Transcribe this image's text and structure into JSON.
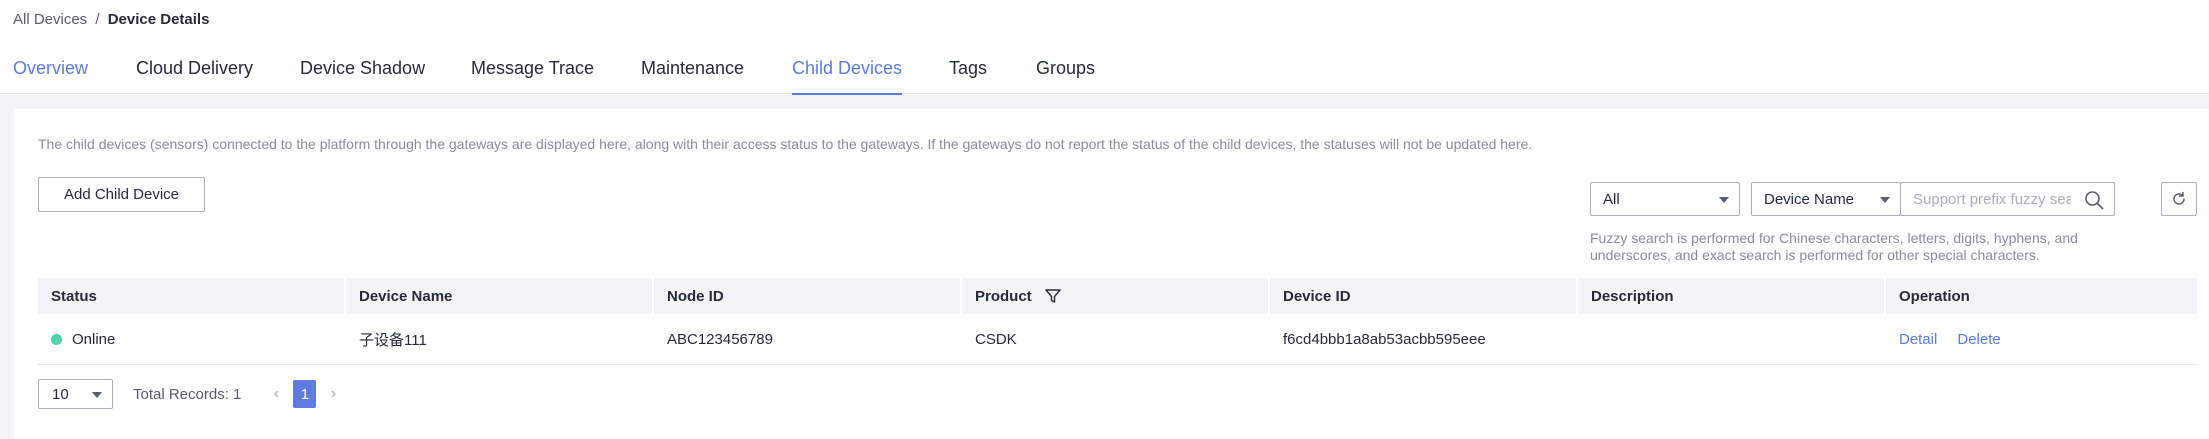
{
  "breadcrumb": {
    "parent": "All Devices",
    "separator": "/",
    "current": "Device Details"
  },
  "tabs": [
    {
      "label": "Overview"
    },
    {
      "label": "Cloud Delivery"
    },
    {
      "label": "Device Shadow"
    },
    {
      "label": "Message Trace"
    },
    {
      "label": "Maintenance"
    },
    {
      "label": "Child Devices"
    },
    {
      "label": "Tags"
    },
    {
      "label": "Groups"
    }
  ],
  "active_tab": "Child Devices",
  "hint": "The child devices (sensors) connected to the platform through the gateways are displayed here, along with their access status to the gateways. If the gateways do not report the status of the child devices, the statuses will not be updated here.",
  "toolbar": {
    "add_label": "Add Child Device",
    "status_filter": "All",
    "search_field": "Device Name",
    "search_placeholder": "Support prefix fuzzy search",
    "search_value": ""
  },
  "fuzzy_note": "Fuzzy search is performed for Chinese characters, letters, digits, hyphens, and underscores, and exact search is performed for other special characters.",
  "table": {
    "columns": [
      "Status",
      "Device Name",
      "Node ID",
      "Product",
      "Device ID",
      "Description",
      "Operation"
    ],
    "rows": [
      {
        "status": "Online",
        "status_color": "#50d4ab",
        "device_name": "子设备111",
        "node_id": "ABC123456789",
        "product": "CSDK",
        "device_id": "f6cd4bbb1a8ab53acbb595eee",
        "description": "",
        "actions": [
          "Detail",
          "Delete"
        ]
      }
    ]
  },
  "pagination": {
    "page_size": "10",
    "total": "Total Records: 1",
    "current_page": "1"
  },
  "colors": {
    "accent": "#5e7ce0",
    "online": "#50d4ab"
  }
}
